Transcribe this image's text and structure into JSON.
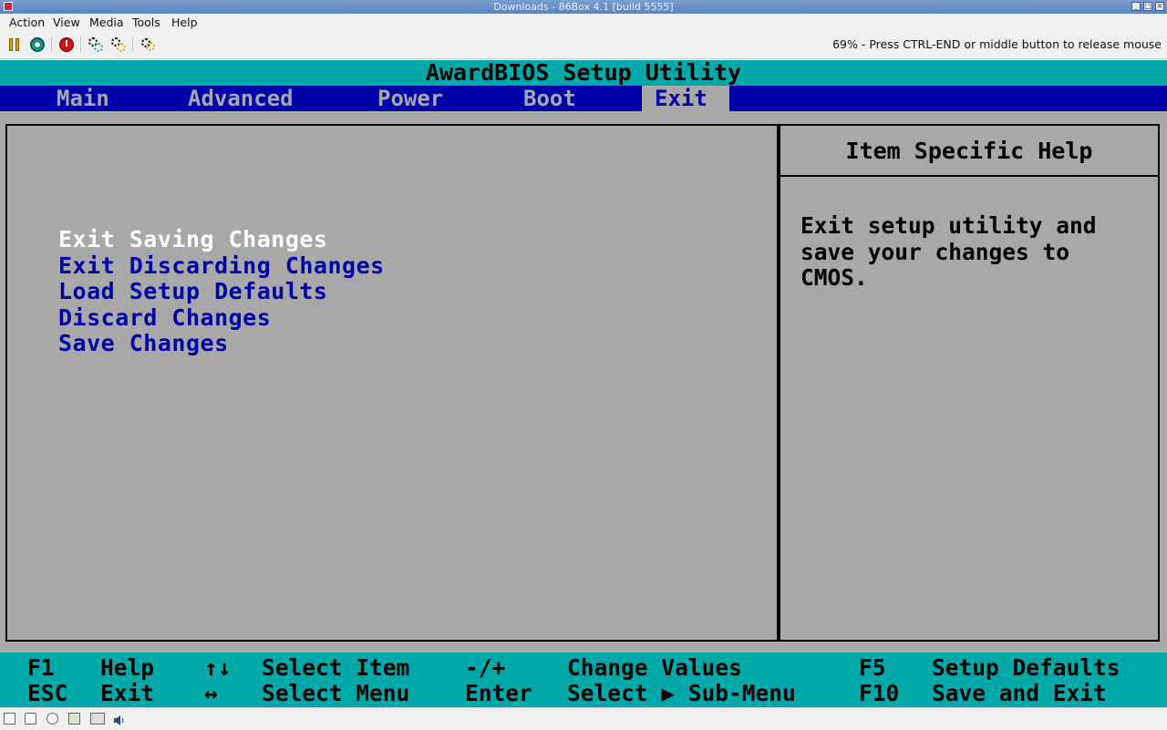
{
  "window": {
    "title": "Downloads - 86Box 4.1 [build 5555]"
  },
  "menubar": {
    "items": [
      "Action",
      "View",
      "Media",
      "Tools",
      "Help"
    ]
  },
  "toolbar": {
    "status": "69% - Press CTRL-END or middle button to release mouse",
    "buttons": [
      "pause-icon",
      "ctrl-alt-del-icon",
      "power-icon",
      "settings-icon",
      "hard-reset-icon",
      "screenshot-icon"
    ]
  },
  "bios": {
    "header": "AwardBIOS Setup Utility",
    "tabs": [
      "Main",
      "Advanced",
      "Power",
      "Boot",
      "Exit"
    ],
    "active_tab": "Exit",
    "menu": [
      "Exit Saving Changes",
      "Exit Discarding Changes",
      "Load Setup Defaults",
      "Discard Changes",
      "Save Changes"
    ],
    "selected_item": "Exit Saving Changes",
    "help_title": "Item Specific Help",
    "help_text": "Exit setup utility and\nsave your changes to\nCMOS.",
    "footer": {
      "row1": [
        {
          "key": "F1",
          "desc": "Help"
        },
        {
          "key": "↑↓",
          "desc": "Select Item"
        },
        {
          "key": "-/+",
          "desc": "Change Values"
        },
        {
          "key": "F5",
          "desc": "Setup Defaults"
        }
      ],
      "row2": [
        {
          "key": "ESC",
          "desc": "Exit"
        },
        {
          "key": "↔",
          "desc": "Select Menu"
        },
        {
          "key": "Enter",
          "desc": "Select ▶ Sub-Menu"
        },
        {
          "key": "F10",
          "desc": "Save and Exit"
        }
      ]
    }
  },
  "statusbar": {
    "icons": [
      "floppy-icon",
      "cdrom-icon",
      "zip-icon",
      "hdd-icon",
      "network-icon",
      "sound-icon"
    ]
  },
  "colors": {
    "bios_blue": "#0000a8",
    "bios_cyan": "#00a8a8",
    "bios_gray": "#a8a8a8"
  }
}
